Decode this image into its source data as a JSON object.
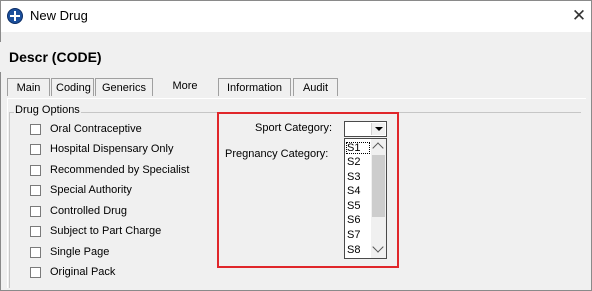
{
  "window": {
    "title": "New Drug",
    "close": "✕"
  },
  "header": {
    "text": "Descr (CODE)"
  },
  "tabs": [
    {
      "label": "Main"
    },
    {
      "label": "Coding"
    },
    {
      "label": "Generics"
    },
    {
      "label": "More",
      "active": true
    },
    {
      "label": "Information"
    },
    {
      "label": "Audit"
    }
  ],
  "drug_options": {
    "legend": "Drug Options",
    "items": [
      {
        "label": "Oral Contraceptive",
        "checked": false
      },
      {
        "label": "Hospital Dispensary Only",
        "checked": false
      },
      {
        "label": "Recommended by Specialist",
        "checked": false
      },
      {
        "label": "Special Authority",
        "checked": false
      },
      {
        "label": "Controlled Drug",
        "checked": false
      },
      {
        "label": "Subject to Part Charge",
        "checked": false
      },
      {
        "label": "Single Page",
        "checked": false
      },
      {
        "label": "Original Pack",
        "checked": false
      }
    ]
  },
  "categories": {
    "sport_label": "Sport Category:",
    "pregnancy_label": "Pregnancy Category:",
    "sport_value": "",
    "options": [
      "S1",
      "S2",
      "S3",
      "S4",
      "S5",
      "S6",
      "S7",
      "S8"
    ],
    "highlight_color": "#e0262a"
  }
}
